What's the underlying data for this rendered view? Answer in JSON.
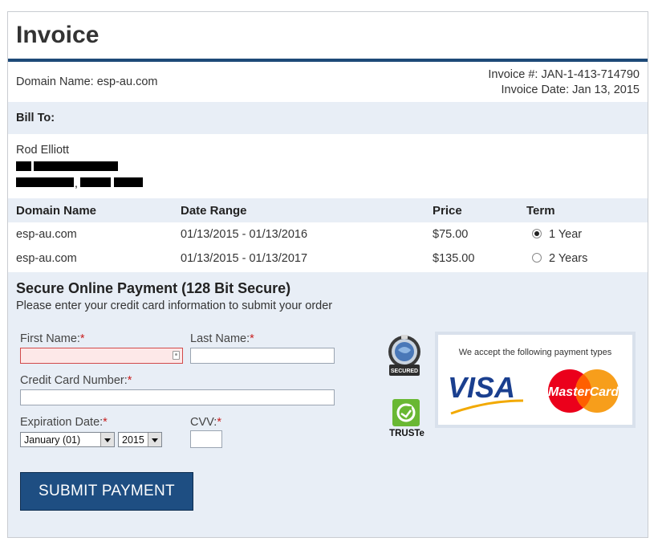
{
  "header": {
    "title": "Invoice"
  },
  "invoice": {
    "domain_name": "Domain Name: esp-au.com",
    "invoice_number": "Invoice #: JAN-1-413-714790",
    "invoice_date": "Invoice Date: Jan 13, 2015"
  },
  "bill_to": {
    "heading": "Bill To:",
    "name": "Rod Elliott"
  },
  "table": {
    "headers": [
      "Domain Name",
      "Date Range",
      "Price",
      "Term"
    ],
    "rows": [
      {
        "domain": "esp-au.com",
        "date_range": "01/13/2015 - 01/13/2016",
        "price": "$75.00",
        "term": "1 Year",
        "selected": true
      },
      {
        "domain": "esp-au.com",
        "date_range": "01/13/2015 - 01/13/2017",
        "price": "$135.00",
        "term": "2 Years",
        "selected": false
      }
    ]
  },
  "payment": {
    "title": "Secure Online Payment (128 Bit Secure)",
    "subtitle": "Please enter your credit card information to submit your order",
    "first_name_label": "First Name:",
    "last_name_label": "Last Name:",
    "card_label": "Credit Card Number:",
    "expiration_label": "Expiration Date:",
    "cvv_label": "CVV:",
    "required_mark": "*",
    "month_selected": "January (01)",
    "year_selected": "2015",
    "submit_label": "SUBMIT PAYMENT"
  },
  "badges": {
    "seal_text": "SECURED",
    "truste_text": "TRUSTe",
    "accept_heading": "We accept the following payment types",
    "visa_text": "VISA",
    "mastercard_text": "MasterCard"
  },
  "colors": {
    "accent": "#1e4a78",
    "band": "#e8eef6",
    "button": "#1e4e82",
    "error_bg": "#fde8e8",
    "required": "#c81e1e",
    "truste_green": "#69b833",
    "visa_blue": "#1a3f8f",
    "visa_gold": "#f2a900",
    "mc_red": "#eb001b",
    "mc_yellow": "#f79e1b"
  }
}
